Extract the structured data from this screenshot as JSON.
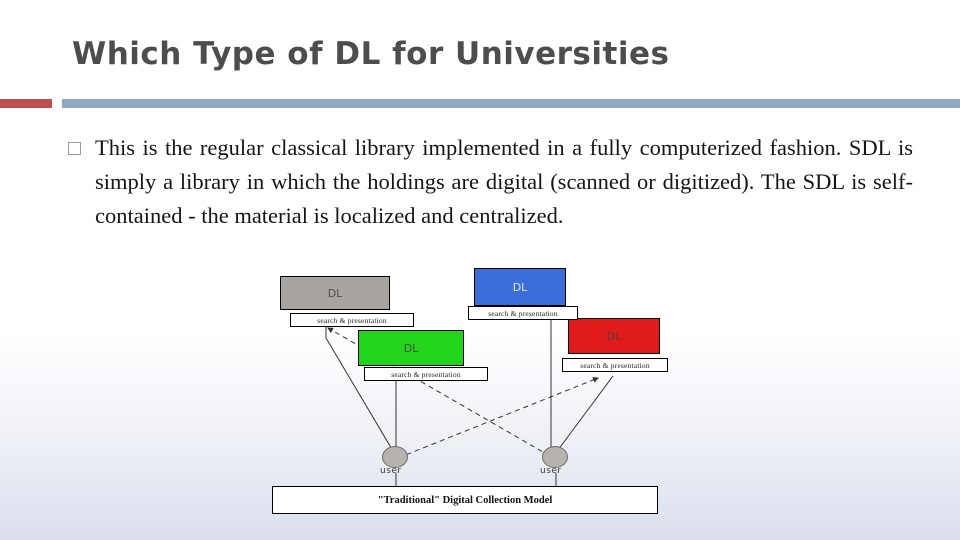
{
  "slide": {
    "title": "Which Type of DL for Universities",
    "bullet_icon": "empty-square-bullet",
    "paragraph": "This is the regular classical library implemented in a fully computerized fashion. SDL is simply a library in which the holdings are digital (scanned or digitized). The SDL is self-contained - the material is localized and centralized.",
    "accent_bar_color": "#8da9c4",
    "accent_bar_secondary_color": "#c0504d"
  },
  "figure": {
    "caption": "\"Traditional\" Digital Collection Model",
    "nodes": [
      {
        "label": "DL",
        "color": "#a8a5a0",
        "name": "dl-node-grey"
      },
      {
        "label": "DL",
        "color": "#3b6ddb",
        "name": "dl-node-blue"
      },
      {
        "label": "DL",
        "color": "#21d61a",
        "name": "dl-node-green"
      },
      {
        "label": "DL",
        "color": "#e01b1b",
        "name": "dl-node-red"
      }
    ],
    "service_labels": [
      "search & presentation",
      "search & presentation",
      "search & presentation",
      "search & presentation"
    ],
    "users": [
      {
        "label": "user"
      },
      {
        "label": "user"
      }
    ]
  }
}
